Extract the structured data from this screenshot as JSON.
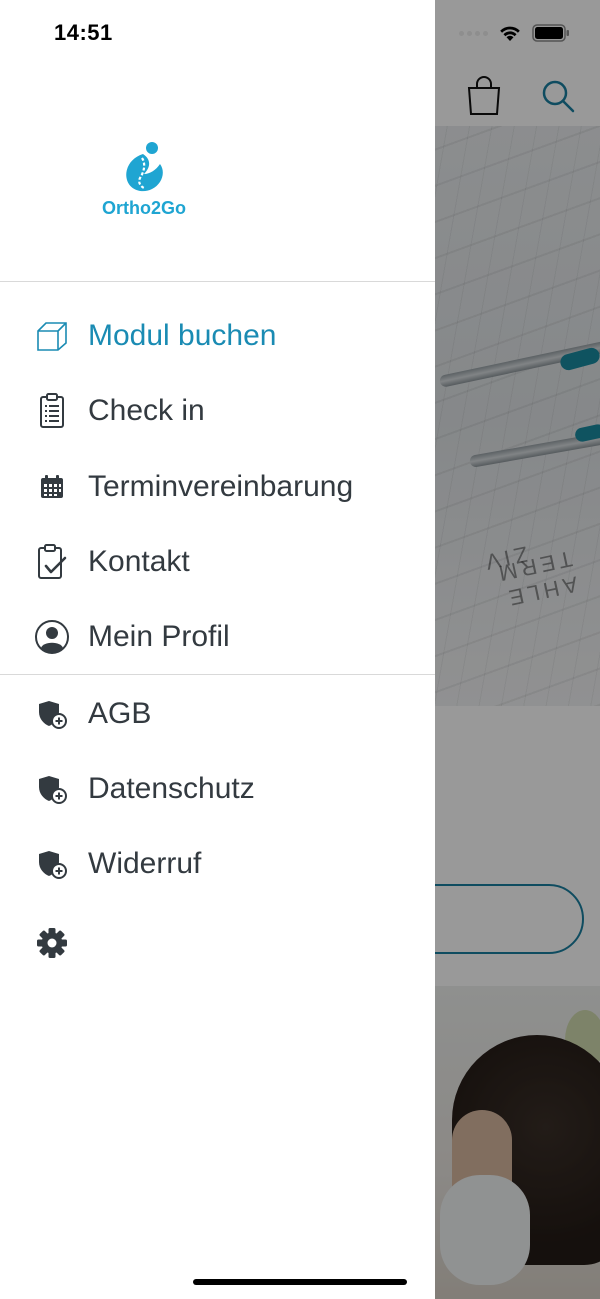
{
  "status_bar": {
    "time": "14:51"
  },
  "app_logo": {
    "text": "Ortho2Go",
    "brand_color": "#1fa5d2"
  },
  "colors": {
    "accent": "#1a8bb3",
    "menu_text": "#333a40",
    "icon": "#333a40"
  },
  "drawer": {
    "primary_items": [
      {
        "label": "Modul buchen",
        "icon": "box-icon",
        "active": true
      },
      {
        "label": "Check in",
        "icon": "clipboard-list-icon",
        "active": false
      },
      {
        "label": "Terminvereinbarung",
        "icon": "calendar-icon",
        "active": false
      },
      {
        "label": "Kontakt",
        "icon": "clipboard-check-icon",
        "active": false
      },
      {
        "label": "Mein Profil",
        "icon": "user-circle-icon",
        "active": false
      }
    ],
    "legal_items": [
      {
        "label": "AGB",
        "icon": "shield-plus-icon"
      },
      {
        "label": "Datenschutz",
        "icon": "shield-plus-icon"
      },
      {
        "label": "Widerruf",
        "icon": "shield-plus-icon"
      }
    ],
    "settings_icon": "gear-icon"
  },
  "background_app": {
    "header_icons": [
      "shopping-bag-icon",
      "search-icon"
    ]
  }
}
